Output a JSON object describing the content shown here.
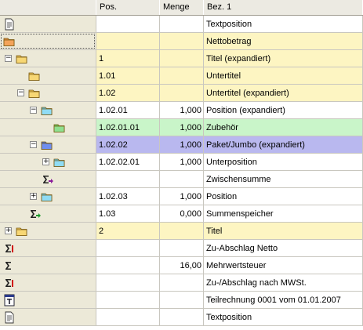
{
  "columns": [
    "",
    "Pos.",
    "Menge",
    "Bez. 1"
  ],
  "rows": [
    {
      "pos": "",
      "menge": "",
      "bez": "Textposition"
    },
    {
      "pos": "",
      "menge": "",
      "bez": "Nettobetrag"
    },
    {
      "pos": "1",
      "menge": "",
      "bez": "Titel (expandiert)"
    },
    {
      "pos": "1.01",
      "menge": "",
      "bez": "Untertitel"
    },
    {
      "pos": "1.02",
      "menge": "",
      "bez": "Untertitel (expandiert)"
    },
    {
      "pos": "1.02.01",
      "menge": "1,000",
      "bez": "Position (expandiert)"
    },
    {
      "pos": "1.02.01.01",
      "menge": "1,000",
      "bez": "Zubehör"
    },
    {
      "pos": "1.02.02",
      "menge": "1,000",
      "bez": "Paket/Jumbo (expandiert)"
    },
    {
      "pos": "1.02.02.01",
      "menge": "1,000",
      "bez": "Unterposition"
    },
    {
      "pos": "",
      "menge": "",
      "bez": "Zwischensumme"
    },
    {
      "pos": "1.02.03",
      "menge": "1,000",
      "bez": "Position"
    },
    {
      "pos": "1.03",
      "menge": "0,000",
      "bez": "Summenspeicher"
    },
    {
      "pos": "2",
      "menge": "",
      "bez": "Titel"
    },
    {
      "pos": "",
      "menge": "",
      "bez": "Zu-Abschlag Netto"
    },
    {
      "pos": "",
      "menge": "16,00",
      "bez": "Mehrwertsteuer"
    },
    {
      "pos": "",
      "menge": "",
      "bez": "Zu-/Abschlag nach MWSt."
    },
    {
      "pos": "",
      "menge": "",
      "bez": "Teilrechnung 0001 vom 01.01.2007"
    },
    {
      "pos": "",
      "menge": "",
      "bez": "Textposition"
    }
  ],
  "row_icons": [
    "document-icon",
    "folder-orange-icon",
    "folder-yellow-icon",
    "folder-yellow-icon",
    "folder-yellow-icon",
    "folder-cyan-icon",
    "folder-green-icon",
    "folder-blue-icon",
    "folder-cyan-icon",
    "sigma-purple-arrow-icon",
    "folder-cyan-icon",
    "sigma-green-arrow-icon",
    "folder-yellow-icon",
    "sigma-red-icon",
    "sigma-icon",
    "sigma-red-icon",
    "partial-invoice-icon",
    "document-icon"
  ],
  "colors": {
    "header_bg": "#eceae2",
    "title_row": "#fdf5c2",
    "accessory_row": "#c9f5c9",
    "package_row": "#b9b8ef",
    "tree_column": "#ece9d8"
  }
}
